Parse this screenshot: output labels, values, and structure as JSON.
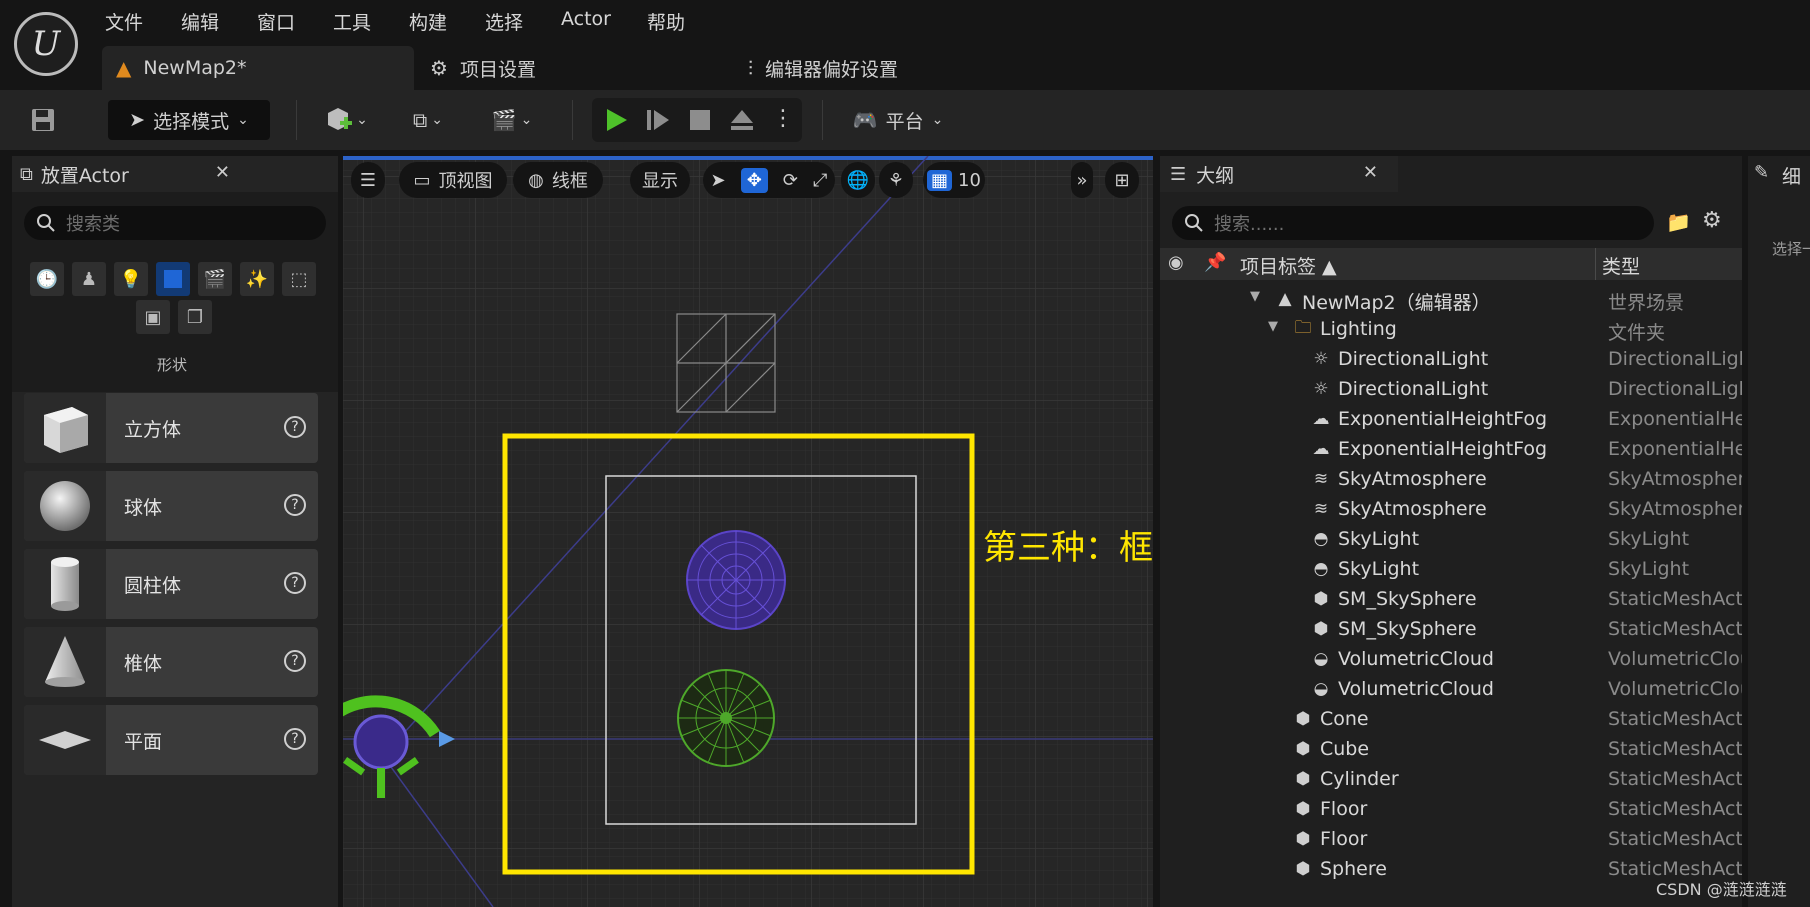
{
  "menu": {
    "logo_glyph": "U",
    "items": [
      "文件",
      "编辑",
      "窗口",
      "工具",
      "构建",
      "选择",
      "Actor",
      "帮助"
    ]
  },
  "tabs": {
    "map": "NewMap2*",
    "project_settings": "项目设置",
    "editor_prefs": "编辑器偏好设置"
  },
  "toolbar": {
    "mode_label": "选择模式",
    "platform_label": "平台"
  },
  "place_actor": {
    "title": "放置Actor",
    "search_placeholder": "搜索类",
    "category_label": "形状",
    "shapes": [
      {
        "label": "立方体"
      },
      {
        "label": "球体"
      },
      {
        "label": "圆柱体"
      },
      {
        "label": "椎体"
      },
      {
        "label": "平面"
      }
    ]
  },
  "viewport": {
    "view_label": "顶视图",
    "render_label": "线框",
    "show_label": "显示",
    "grid_value": "10",
    "annotation": "第三种：框选",
    "annotation_color": "#ffe600"
  },
  "outliner": {
    "title": "大纲",
    "search_placeholder": "搜索......",
    "col_label": "项目标签 ▲",
    "col_type": "类型",
    "rows": [
      {
        "label": "NewMap2（编辑器）",
        "type": "世界场景",
        "indent": 0,
        "icon": "map-icon"
      },
      {
        "label": "Lighting",
        "type": "文件夹",
        "indent": 1,
        "icon": "folder-icon"
      },
      {
        "label": "DirectionalLight",
        "type": "DirectionalLigh",
        "indent": 2,
        "icon": "sun-icon"
      },
      {
        "label": "DirectionalLight",
        "type": "DirectionalLigh",
        "indent": 2,
        "icon": "sun-icon"
      },
      {
        "label": "ExponentialHeightFog",
        "type": "ExponentialHei",
        "indent": 2,
        "icon": "fog-icon"
      },
      {
        "label": "ExponentialHeightFog",
        "type": "ExponentialHei",
        "indent": 2,
        "icon": "fog-icon"
      },
      {
        "label": "SkyAtmosphere",
        "type": "SkyAtmosphere",
        "indent": 2,
        "icon": "atmosphere-icon"
      },
      {
        "label": "SkyAtmosphere",
        "type": "SkyAtmosphere",
        "indent": 2,
        "icon": "atmosphere-icon"
      },
      {
        "label": "SkyLight",
        "type": "SkyLight",
        "indent": 2,
        "icon": "skylight-icon"
      },
      {
        "label": "SkyLight",
        "type": "SkyLight",
        "indent": 2,
        "icon": "skylight-icon"
      },
      {
        "label": "SM_SkySphere",
        "type": "StaticMeshActo",
        "indent": 2,
        "icon": "mesh-icon"
      },
      {
        "label": "SM_SkySphere",
        "type": "StaticMeshActo",
        "indent": 2,
        "icon": "mesh-icon"
      },
      {
        "label": "VolumetricCloud",
        "type": "VolumetricClou",
        "indent": 2,
        "icon": "cloud-icon"
      },
      {
        "label": "VolumetricCloud",
        "type": "VolumetricClou",
        "indent": 2,
        "icon": "cloud-icon"
      },
      {
        "label": "Cone",
        "type": "StaticMeshActo",
        "indent": 1,
        "icon": "mesh-icon"
      },
      {
        "label": "Cube",
        "type": "StaticMeshActo",
        "indent": 1,
        "icon": "mesh-icon"
      },
      {
        "label": "Cylinder",
        "type": "StaticMeshActo",
        "indent": 1,
        "icon": "mesh-icon"
      },
      {
        "label": "Floor",
        "type": "StaticMeshActo",
        "indent": 1,
        "icon": "mesh-icon"
      },
      {
        "label": "Floor",
        "type": "StaticMeshActo",
        "indent": 1,
        "icon": "mesh-icon"
      },
      {
        "label": "Sphere",
        "type": "StaticMeshActo",
        "indent": 1,
        "icon": "mesh-icon"
      }
    ]
  },
  "details": {
    "title": "细",
    "hint": "选择一"
  },
  "watermark": "CSDN @涟涟涟涟"
}
